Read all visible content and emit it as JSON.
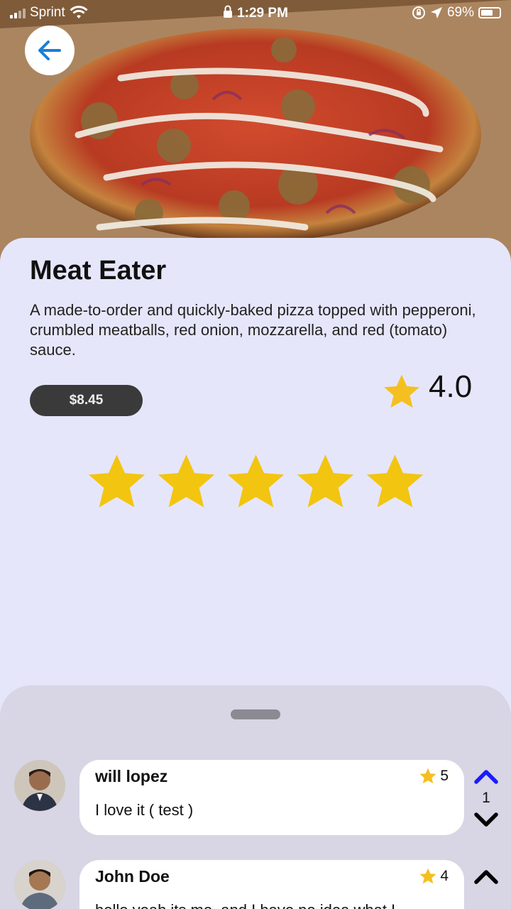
{
  "status_bar": {
    "carrier": "Sprint",
    "time": "1:29 PM",
    "battery": "69%"
  },
  "item": {
    "name": "Meat Eater",
    "description": "A made-to-order and quickly-baked pizza topped with pepperoni, crumbled meatballs, red onion, mozzarella, and red (tomato) sauce.",
    "price": "$8.45",
    "average_rating": "4.0"
  },
  "rating_input": {
    "star_count": 5,
    "star_color": "#f2c511"
  },
  "reviews": [
    {
      "author": "will lopez",
      "text": "I love it ( test )",
      "rating": "5",
      "votes": "1",
      "upvote_color": "#1a1aff"
    },
    {
      "author": "John Doe",
      "text": "hello yeah its me, and I have no idea what I",
      "rating": "4",
      "votes": "",
      "upvote_color": "#000000"
    }
  ],
  "colors": {
    "panel_bg": "#e6e6fa",
    "sheet_bg": "#d8d5e4",
    "price_bg": "#3a3a3a",
    "accent_blue": "#1a7fd6",
    "star_gold": "#f2c511"
  },
  "icons": {
    "back": "arrow-left-icon",
    "wifi": "wifi-icon",
    "lock": "lock-icon",
    "location": "location-arrow-icon",
    "rotation_lock": "rotation-lock-icon",
    "star": "star-icon",
    "upvote": "chevron-up-icon",
    "downvote": "chevron-down-icon"
  }
}
